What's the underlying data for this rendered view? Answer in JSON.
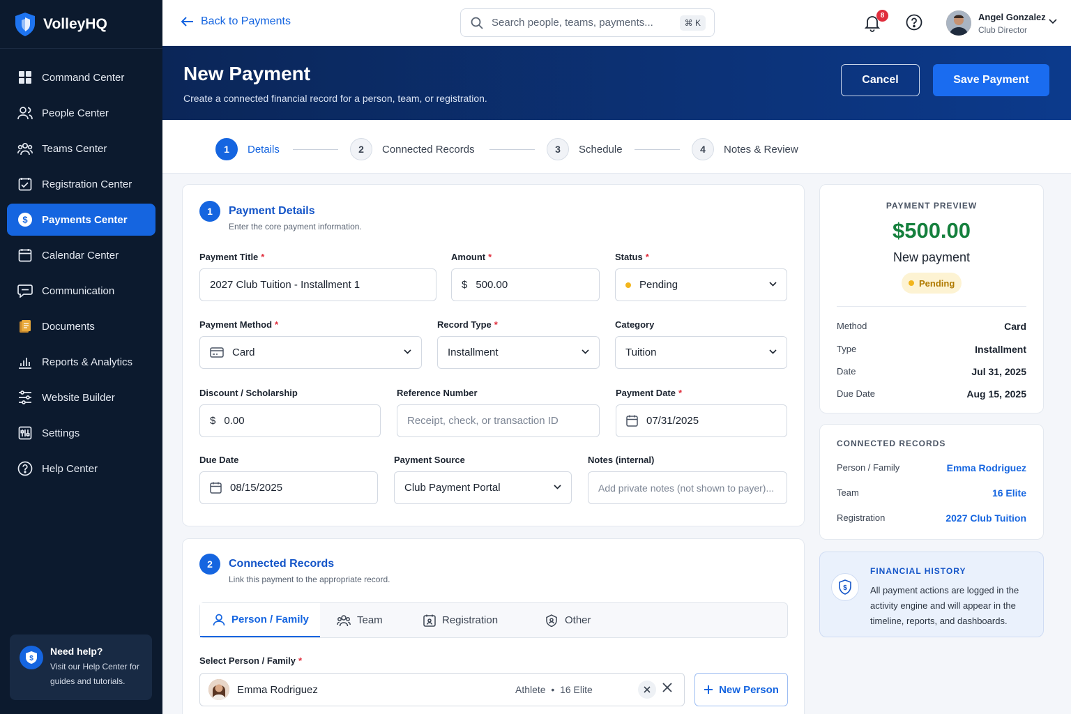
{
  "app": {
    "name": "VolleyHQ"
  },
  "sidebar": {
    "items": [
      {
        "label": "Command Center",
        "icon": "grid-icon"
      },
      {
        "label": "People Center",
        "icon": "people-icon"
      },
      {
        "label": "Teams Center",
        "icon": "teams-icon"
      },
      {
        "label": "Registration Center",
        "icon": "registration-icon"
      },
      {
        "label": "Payments Center",
        "icon": "dollar-icon",
        "active": true
      },
      {
        "label": "Calendar Center",
        "icon": "calendar-icon"
      },
      {
        "label": "Communication",
        "icon": "chat-icon"
      },
      {
        "label": "Documents",
        "icon": "documents-icon"
      },
      {
        "label": "Reports & Analytics",
        "icon": "chart-icon"
      },
      {
        "label": "Website Builder",
        "icon": "builder-icon"
      },
      {
        "label": "Settings",
        "icon": "settings-icon"
      },
      {
        "label": "Help Center",
        "icon": "help-icon"
      }
    ],
    "help": {
      "title": "Need help?",
      "text": "Visit our Help Center for guides and tutorials."
    }
  },
  "topbar": {
    "back_label": "Back to Payments",
    "search_placeholder": "Search people, teams, payments...",
    "search_shortcut": "⌘ K",
    "notifications_count": "8",
    "user": {
      "name": "Angel Gonzalez",
      "role": "Club Director"
    }
  },
  "header": {
    "title": "New Payment",
    "subtitle": "Create a connected financial record for a person, team, or registration.",
    "cancel_label": "Cancel",
    "save_label": "Save Payment"
  },
  "stepper": [
    {
      "num": "1",
      "label": "Details",
      "active": true
    },
    {
      "num": "2",
      "label": "Connected Records"
    },
    {
      "num": "3",
      "label": "Schedule"
    },
    {
      "num": "4",
      "label": "Notes & Review"
    }
  ],
  "details": {
    "num": "1",
    "title": "Payment Details",
    "subtitle": "Enter the core payment information.",
    "required_mark": "*",
    "fields": {
      "title": {
        "label": "Payment Title",
        "value": "2027 Club Tuition - Installment 1"
      },
      "amount": {
        "label": "Amount",
        "prefix": "$",
        "value": "500.00"
      },
      "status": {
        "label": "Status",
        "value": "Pending"
      },
      "method": {
        "label": "Payment Method",
        "value": "Card"
      },
      "record_type": {
        "label": "Record Type",
        "value": "Installment"
      },
      "category": {
        "label": "Category",
        "value": "Tuition"
      },
      "discount": {
        "label": "Discount / Scholarship",
        "prefix": "$",
        "value": "0.00"
      },
      "reference": {
        "label": "Reference Number",
        "placeholder": "Receipt, check, or transaction ID"
      },
      "payment_date": {
        "label": "Payment Date",
        "value": "07/31/2025"
      },
      "due_date": {
        "label": "Due Date",
        "value": "08/15/2025"
      },
      "source": {
        "label": "Payment Source",
        "value": "Club Payment Portal"
      },
      "notes": {
        "label": "Notes (internal)",
        "placeholder": "Add private notes (not shown to payer)..."
      }
    }
  },
  "connected": {
    "num": "2",
    "title": "Connected Records",
    "subtitle": "Link this payment to the appropriate record.",
    "tabs": [
      {
        "label": "Person / Family",
        "active": true
      },
      {
        "label": "Team"
      },
      {
        "label": "Registration"
      },
      {
        "label": "Other"
      }
    ],
    "select_label": "Select Person / Family",
    "selected": {
      "name": "Emma Rodriguez",
      "role": "Athlete",
      "separator": "•",
      "team": "16 Elite"
    },
    "new_person_label": "New Person"
  },
  "preview": {
    "label": "PAYMENT PREVIEW",
    "amount": "$500.00",
    "name": "New payment",
    "status": "Pending",
    "rows": [
      {
        "label": "Method",
        "value": "Card"
      },
      {
        "label": "Type",
        "value": "Installment"
      },
      {
        "label": "Date",
        "value": "Jul 31, 2025"
      },
      {
        "label": "Due Date",
        "value": "Aug 15, 2025"
      }
    ]
  },
  "connected_records": {
    "label": "CONNECTED RECORDS",
    "rows": [
      {
        "label": "Person / Family",
        "value": "Emma Rodriguez"
      },
      {
        "label": "Team",
        "value": "16 Elite"
      },
      {
        "label": "Registration",
        "value": "2027 Club Tuition"
      }
    ]
  },
  "financial_history": {
    "title": "FINANCIAL HISTORY",
    "text": "All payment actions are logged in the activity engine and will appear in the timeline, reports, and dashboards."
  },
  "colors": {
    "primary": "#1565e0",
    "sidebar": "#0c1a2e",
    "header_band": "#0c3a8c",
    "amount": "#15803d",
    "pending": "#f2b51c"
  }
}
